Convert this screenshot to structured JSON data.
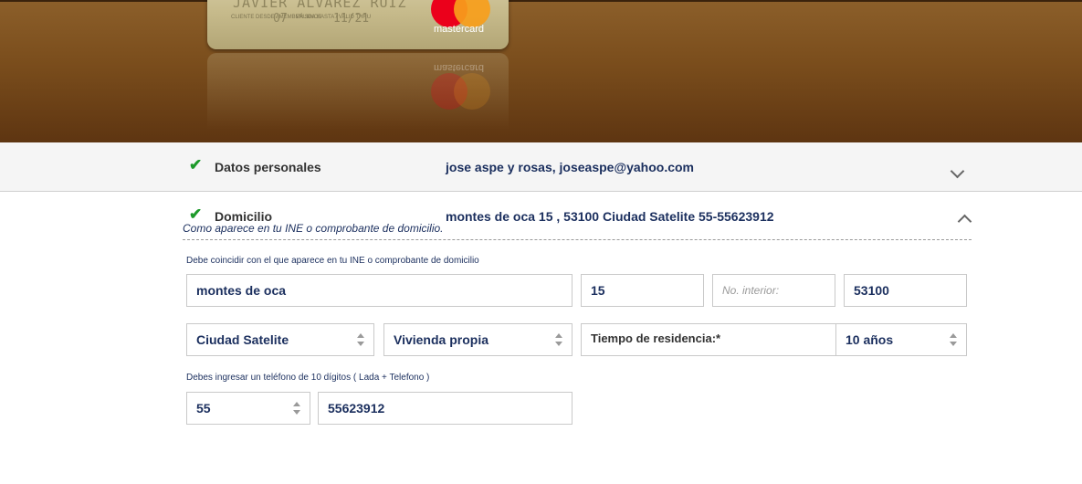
{
  "banner": {
    "card": {
      "holder_name": "JAVIER ALVAREZ RUIZ",
      "member_since_label": "CLIENTE DESDE / MEMBER SINCE",
      "member_since": "07",
      "valid_thru_label": "VÁLIDA HASTA / VALID THRU",
      "valid_thru": "11/21",
      "brand": "mastercard"
    }
  },
  "sections": {
    "personal": {
      "title": "Datos personales",
      "summary": "jose aspe y rosas, joseaspe@yahoo.com",
      "completed": true,
      "expanded": false
    },
    "address": {
      "title": "Domicilio",
      "summary": "montes de oca 15 , 53100 Ciudad Satelite 55-55623912",
      "completed": true,
      "expanded": true,
      "hint": "Como aparece en tu INE o comprobante de domicilio.",
      "help_address": "Debe coincidir con el que aparece en tu INE o comprobante de domicilio",
      "street": "montes de oca",
      "exterior_number": "15",
      "interior_placeholder": "No. interior:",
      "postal_code": "53100",
      "colonia": "Ciudad Satelite",
      "housing_type": "Vivienda propia",
      "residence_label": "Tiempo de residencia:*",
      "residence_time": "10 años",
      "help_phone": "Debes ingresar un teléfono de 10 dígitos ( Lada + Telefono )",
      "phone_area": "55",
      "phone_number": "55623912"
    }
  },
  "colors": {
    "accent_text": "#1b2f5e",
    "check_green": "#1d9a2a",
    "banner_brown": "#7a4d1c",
    "mc_red": "#eb001b",
    "mc_orange": "#f79e1b"
  }
}
